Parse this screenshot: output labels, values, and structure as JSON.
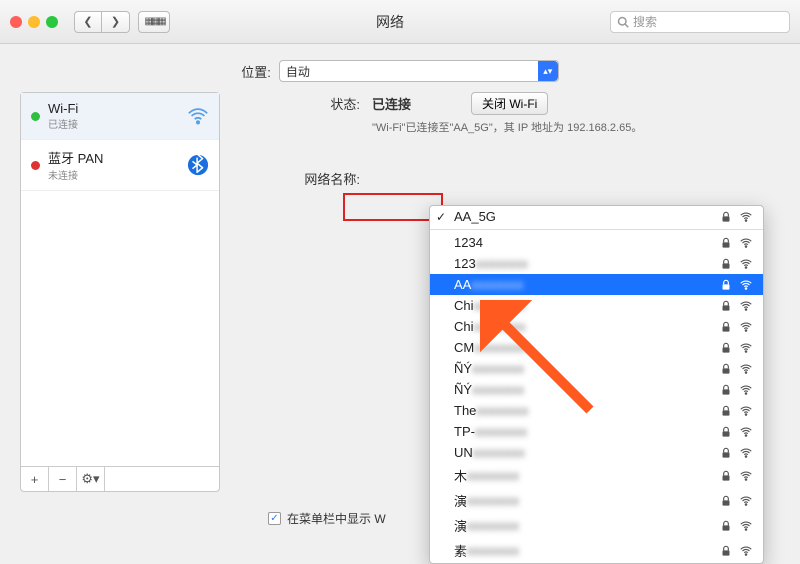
{
  "window": {
    "title": "网络"
  },
  "toolbar": {
    "search_placeholder": "搜索"
  },
  "location": {
    "label": "位置:",
    "value": "自动"
  },
  "sidebar": {
    "services": [
      {
        "name": "Wi-Fi",
        "status": "已连接",
        "dot": "#2fbf3f",
        "icon": "wifi"
      },
      {
        "name": "蓝牙 PAN",
        "status": "未连接",
        "dot": "#d33",
        "icon": "bluetooth"
      }
    ]
  },
  "main": {
    "status_label": "状态:",
    "status_value": "已连接",
    "turn_off_button": "关闭 Wi-Fi",
    "status_desc": "\"Wi-Fi\"已连接至\"AA_5G\"，其 IP 地址为 192.168.2.65。",
    "network_name_label": "网络名称:",
    "show_in_menu_bar": "在菜单栏中显示 W"
  },
  "dropdown": {
    "current": "AA_5G",
    "items": [
      {
        "label": "1234",
        "locked": true
      },
      {
        "label": "123",
        "suffix": "blur",
        "locked": true
      },
      {
        "label": "AA",
        "suffix": "blur",
        "locked": true,
        "selected": true
      },
      {
        "label": "Chi",
        "suffix": "blur",
        "locked": true
      },
      {
        "label": "Chi",
        "suffix": "blur",
        "locked": true
      },
      {
        "label": "CM",
        "suffix": "blur",
        "locked": true
      },
      {
        "label": "ÑÝ",
        "suffix": "blur",
        "locked": true
      },
      {
        "label": "ÑÝ",
        "suffix": "blur",
        "locked": true
      },
      {
        "label": "The",
        "suffix": "blur",
        "locked": true
      },
      {
        "label": "TP-",
        "suffix": "blur",
        "locked": true
      },
      {
        "label": "UN",
        "suffix": "blur",
        "locked": true
      },
      {
        "label": "木",
        "suffix": "blur",
        "locked": true
      },
      {
        "label": "演",
        "suffix": "blur",
        "locked": true
      },
      {
        "label": "演",
        "suffix": "blur",
        "locked": true
      },
      {
        "label": "素",
        "suffix": "blur",
        "locked": true
      }
    ]
  }
}
